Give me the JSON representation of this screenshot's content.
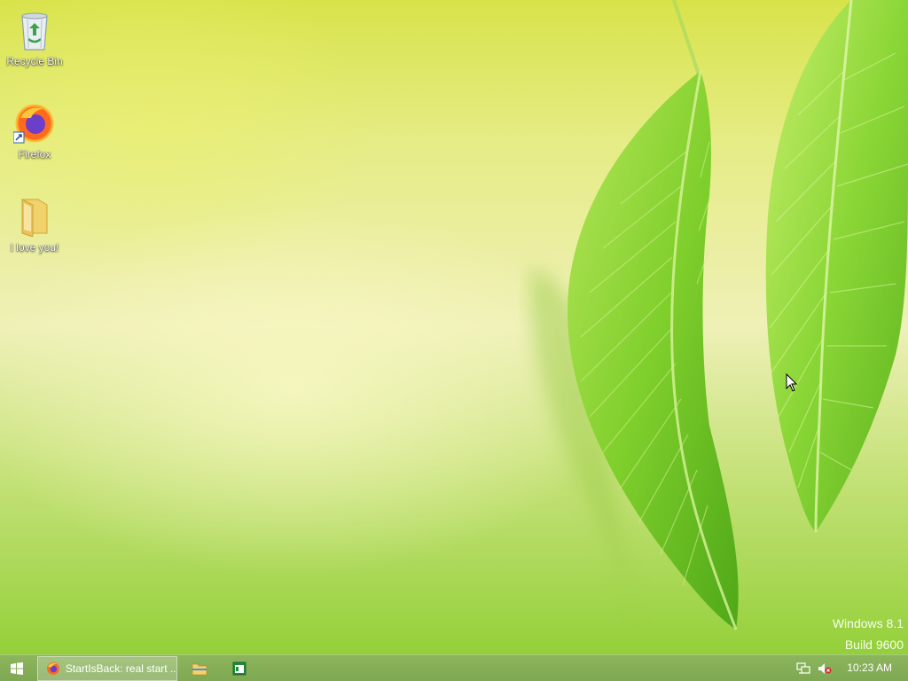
{
  "desktop": {
    "icons": [
      {
        "label": "Recycle Bin",
        "icon": "recycle-bin-icon"
      },
      {
        "label": "Firefox",
        "icon": "firefox-icon"
      },
      {
        "label": "I love you!",
        "icon": "folder-icon"
      }
    ],
    "watermark": {
      "line1": "Windows 8.1",
      "line2": "Build 9600"
    }
  },
  "taskbar": {
    "start_icon": "windows-logo-icon",
    "running": {
      "label": "StartIsBack: real start ...",
      "icon": "firefox-icon"
    },
    "pinned": [
      {
        "icon": "file-explorer-icon"
      },
      {
        "icon": "green-window-app-icon"
      }
    ],
    "tray": {
      "network_icon": "network-icon",
      "volume_icon": "volume-muted-icon",
      "clock": "10:23 AM"
    }
  },
  "colors": {
    "taskbar": "#86af58",
    "wallpaper_top": "#d8e34a",
    "wallpaper_bottom": "#94d03a"
  }
}
